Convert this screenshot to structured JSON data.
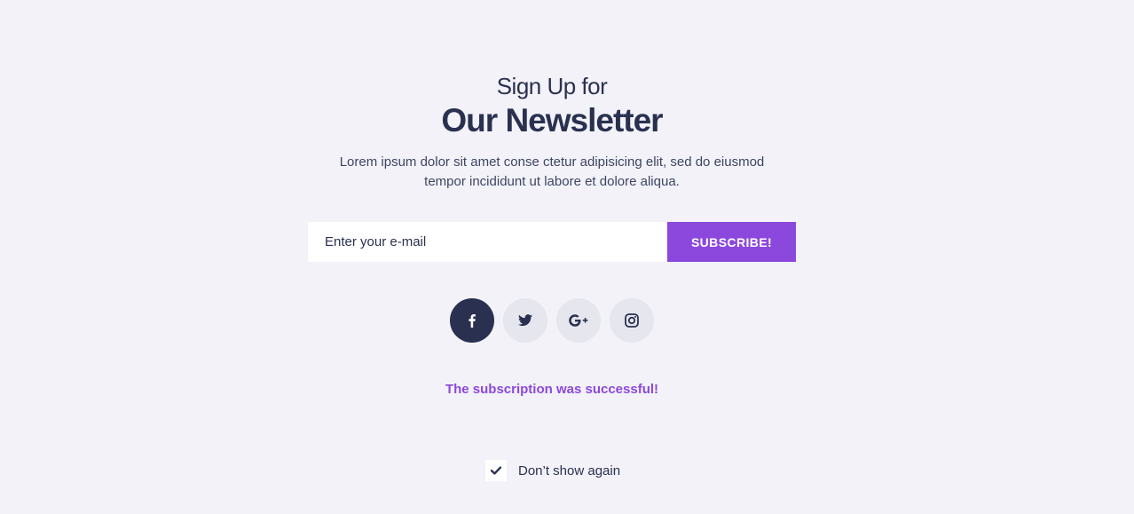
{
  "newsletter": {
    "subtitle": "Sign Up for",
    "title": "Our Newsletter",
    "description_line1": "Lorem ipsum dolor sit amet conse ctetur adipisicing elit, sed do eiusmod",
    "description_line2": "tempor incididunt ut labore et dolore aliqua.",
    "email_placeholder": "Enter your e-mail",
    "email_value": "",
    "subscribe_label": "SUBSCRIBE!",
    "success_message": "The subscription was successful!",
    "dont_show_label": "Don’t show again",
    "dont_show_checked": true
  },
  "socials": [
    {
      "name": "facebook",
      "icon": "facebook-icon",
      "active": true
    },
    {
      "name": "twitter",
      "icon": "twitter-icon",
      "active": false
    },
    {
      "name": "google-plus",
      "icon": "google-plus-icon",
      "active": false
    },
    {
      "name": "instagram",
      "icon": "instagram-icon",
      "active": false
    }
  ],
  "colors": {
    "background": "#f2f2f8",
    "text": "#2a3150",
    "accent": "#8c48dd",
    "social_bg": "#e6e6ee",
    "social_active_bg": "#2a3150"
  }
}
